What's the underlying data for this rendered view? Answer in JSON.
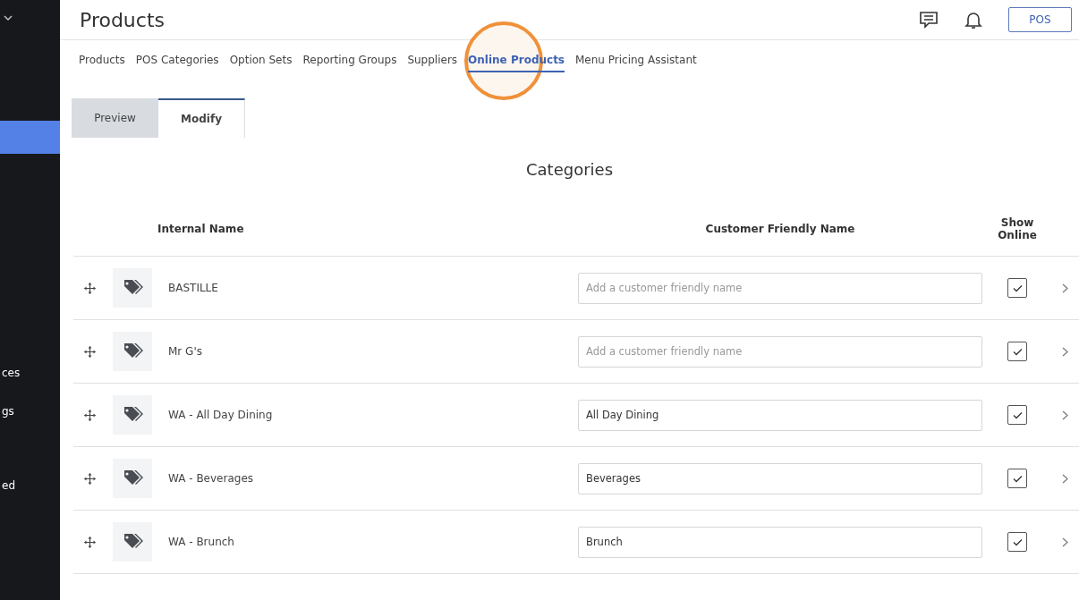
{
  "sidebar": {
    "items": [
      {
        "kind": "chevron",
        "selected": false
      },
      {
        "kind": "blank",
        "selected": true
      },
      {
        "label": "ces",
        "kind": "text",
        "selected": false
      },
      {
        "label": "gs",
        "kind": "text",
        "selected": false
      },
      {
        "label": "ed",
        "kind": "text",
        "selected": false
      }
    ]
  },
  "header": {
    "title": "Products",
    "pos_button": "POS"
  },
  "nav_tabs": [
    {
      "label": "Products",
      "selected": false
    },
    {
      "label": "POS Categories",
      "selected": false
    },
    {
      "label": "Option Sets",
      "selected": false
    },
    {
      "label": "Reporting Groups",
      "selected": false
    },
    {
      "label": "Suppliers",
      "selected": false
    },
    {
      "label": "Online Products",
      "selected": true,
      "highlighted": true
    },
    {
      "label": "Menu Pricing Assistant",
      "selected": false
    }
  ],
  "view_tabs": [
    {
      "label": "Preview",
      "selected": false
    },
    {
      "label": "Modify",
      "selected": true
    }
  ],
  "section_title": "Categories",
  "table": {
    "columns": [
      "Internal Name",
      "Customer Friendly Name",
      "Show Online"
    ],
    "rows": [
      {
        "internal_name": "BASTILLE",
        "friendly_name": {
          "placeholder": "Add a customer friendly name"
        },
        "show_online": true
      },
      {
        "internal_name": "Mr G's",
        "friendly_name": {
          "placeholder": "Add a customer friendly name"
        },
        "show_online": true
      },
      {
        "internal_name": "WA - All Day Dining",
        "friendly_name": {
          "value": "All Day Dining"
        },
        "show_online": true
      },
      {
        "internal_name": "WA - Beverages",
        "friendly_name": {
          "value": "Beverages"
        },
        "show_online": true
      },
      {
        "internal_name": "WA - Brunch",
        "friendly_name": {
          "value": "Brunch"
        },
        "show_online": true
      }
    ]
  }
}
